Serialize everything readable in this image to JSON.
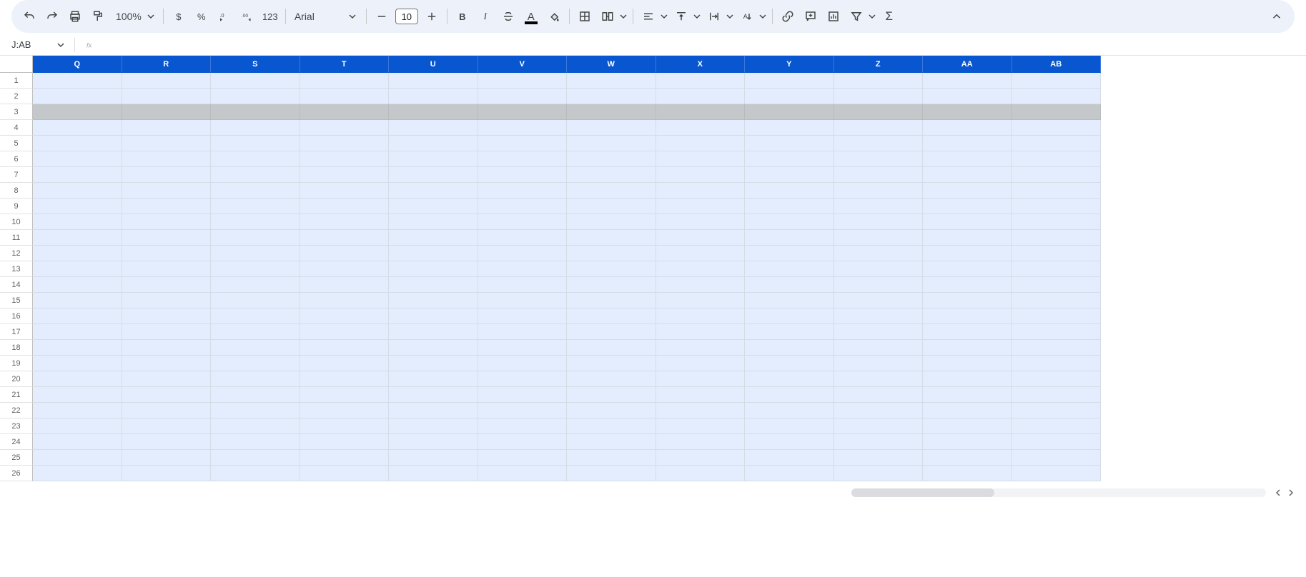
{
  "toolbar": {
    "zoom": "100%",
    "format_123": "123",
    "font_name": "Arial",
    "font_size": "10"
  },
  "namebox": {
    "value": "J:AB"
  },
  "columns": [
    "Q",
    "R",
    "S",
    "T",
    "U",
    "V",
    "W",
    "X",
    "Y",
    "Z",
    "AA",
    "AB"
  ],
  "row_count": 26,
  "highlight_row": 3,
  "colors": {
    "header_bg": "#0957d0",
    "cell_bg": "#e3edfd"
  }
}
